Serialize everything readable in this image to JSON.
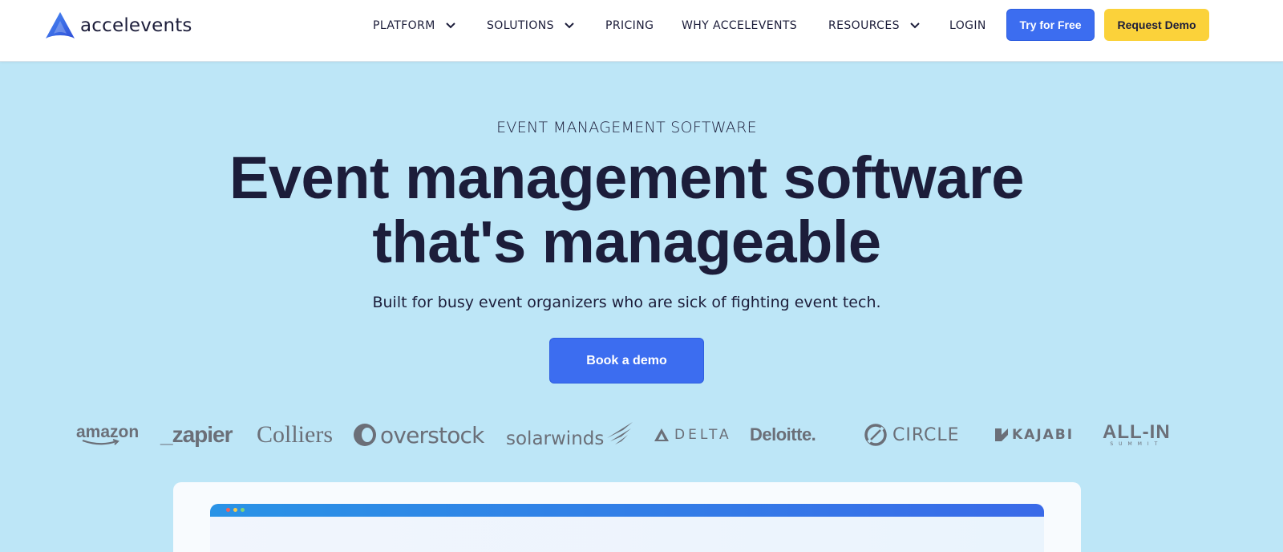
{
  "brand": {
    "name": "accelevents",
    "accent": "#3c6df0",
    "cta_yellow": "#fbd23a",
    "hero_bg": "#bde6f7",
    "text_dark": "#1c1d3a"
  },
  "nav": {
    "items": [
      {
        "label": "PLATFORM",
        "has_dropdown": true,
        "icon": "chevron-down-icon"
      },
      {
        "label": "SOLUTIONS",
        "has_dropdown": true,
        "icon": "chevron-down-icon"
      },
      {
        "label": "PRICING",
        "has_dropdown": false
      },
      {
        "label": "WHY ACCELEVENTS",
        "has_dropdown": false
      },
      {
        "label": "RESOURCES",
        "has_dropdown": true,
        "icon": "chevron-down-icon"
      },
      {
        "label": "LOGIN",
        "has_dropdown": false
      }
    ],
    "try_free_label": "Try for Free",
    "request_demo_label": "Request Demo"
  },
  "hero": {
    "eyebrow": "EVENT MANAGEMENT SOFTWARE",
    "headline_line1": "Event management software",
    "headline_line2": "that's manageable",
    "subhead": "Built for busy event organizers who are sick of fighting event tech.",
    "cta_label": "Book a demo"
  },
  "customer_logos": {
    "amazon": "amazon",
    "zapier": "_zapier",
    "colliers": "Colliers",
    "overstock": "overstock",
    "solarwinds": "solarwinds",
    "delta": "DELTA",
    "deloitte": "Deloitte.",
    "circle": "CIRCLE",
    "kajabi": "KAJABI",
    "allin": "ALL-IN",
    "allin_sub": "SUMMIT"
  },
  "preview": {
    "window_dots": [
      "#f0615d",
      "#f7c94c",
      "#7ed37a"
    ]
  }
}
